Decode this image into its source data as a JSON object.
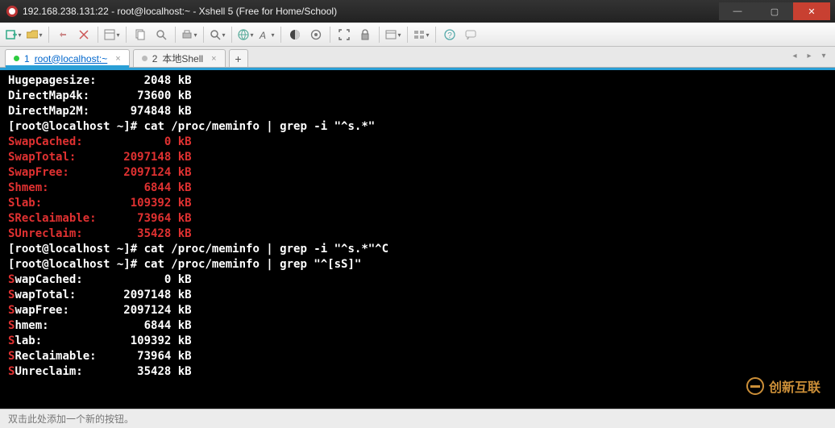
{
  "window": {
    "title": "192.168.238.131:22 - root@localhost:~ - Xshell 5 (Free for Home/School)"
  },
  "tabs": [
    {
      "index": "1",
      "label": "root@localhost:~",
      "active": true,
      "bullet": "green"
    },
    {
      "index": "2",
      "label": "本地Shell",
      "active": false,
      "bullet": "gray"
    }
  ],
  "statusbar": {
    "hint": "双击此处添加一个新的按钮。"
  },
  "watermark": {
    "text": "创新互联"
  },
  "terminal": {
    "plain_lines": [
      {
        "label": "Hugepagesize:",
        "value": "2048",
        "unit": "kB"
      },
      {
        "label": "DirectMap4k:",
        "value": "73600",
        "unit": "kB"
      },
      {
        "label": "DirectMap2M:",
        "value": "974848",
        "unit": "kB"
      }
    ],
    "prompt1": {
      "prompt": "[root@localhost ~]#",
      "cmd": "cat /proc/meminfo | grep -i \"^s.*\""
    },
    "red_block": [
      {
        "label": "SwapCached:",
        "value": "0",
        "unit": "kB"
      },
      {
        "label": "SwapTotal:",
        "value": "2097148",
        "unit": "kB"
      },
      {
        "label": "SwapFree:",
        "value": "2097124",
        "unit": "kB"
      },
      {
        "label": "Shmem:",
        "value": "6844",
        "unit": "kB"
      },
      {
        "label": "Slab:",
        "value": "109392",
        "unit": "kB"
      },
      {
        "label": "SReclaimable:",
        "value": "73964",
        "unit": "kB"
      },
      {
        "label": "SUnreclaim:",
        "value": "35428",
        "unit": "kB"
      }
    ],
    "prompt2": {
      "prompt": "[root@localhost ~]#",
      "cmd": "cat /proc/meminfo | grep -i \"^s.*\"^C"
    },
    "prompt3": {
      "prompt": "[root@localhost ~]#",
      "cmd": "cat /proc/meminfo | grep \"^[sS]\""
    },
    "s_block": [
      {
        "first": "S",
        "label_rest": "wapCached:",
        "value": "0",
        "unit": "kB"
      },
      {
        "first": "S",
        "label_rest": "wapTotal:",
        "value": "2097148",
        "unit": "kB"
      },
      {
        "first": "S",
        "label_rest": "wapFree:",
        "value": "2097124",
        "unit": "kB"
      },
      {
        "first": "S",
        "label_rest": "hmem:",
        "value": "6844",
        "unit": "kB"
      },
      {
        "first": "S",
        "label_rest": "lab:",
        "value": "109392",
        "unit": "kB"
      },
      {
        "first": "S",
        "label_rest": "Reclaimable:",
        "value": "73964",
        "unit": "kB"
      },
      {
        "first": "S",
        "label_rest": "Unreclaim:",
        "value": "35428",
        "unit": "kB"
      }
    ]
  }
}
